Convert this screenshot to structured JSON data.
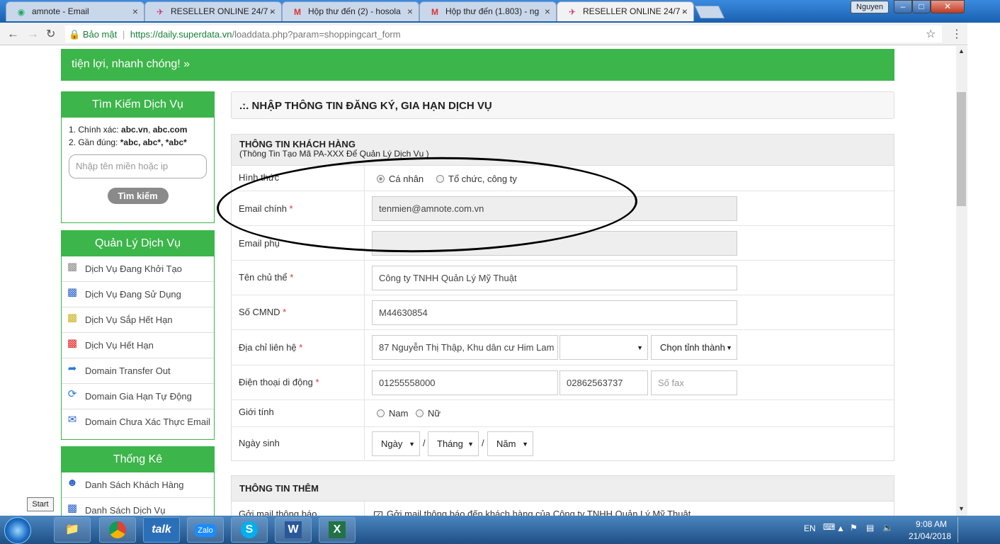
{
  "browser": {
    "tabs": [
      {
        "title": "amnote - Email",
        "icon": "globe-icon"
      },
      {
        "title": "RESELLER ONLINE 24/7 -",
        "icon": "reseller-icon"
      },
      {
        "title": "Hộp thư đến (2) - hosola",
        "icon": "gmail-icon"
      },
      {
        "title": "Hộp thư đến (1.803) - ng",
        "icon": "gmail-icon"
      },
      {
        "title": "RESELLER ONLINE 24/7 -",
        "icon": "reseller-icon",
        "active": true
      }
    ],
    "user": "Nguyen",
    "security_label": "Bảo mật",
    "url_host": "https://daily.superdata.vn",
    "url_path": "/loaddata.php?param=shoppingcart_form"
  },
  "banner": {
    "text": "tiện lợi, nhanh chóng! »"
  },
  "search_box": {
    "title": "Tìm Kiếm Dịch Vụ",
    "hint1_prefix": "1. Chính xác: ",
    "hint1_bold": "abc.vn",
    "hint1_sep": ", ",
    "hint1_bold2": "abc.com",
    "hint2_prefix": "2. Gần đúng: ",
    "hint2_bold": "*abc, abc*, *abc*",
    "placeholder": "Nhập tên miền hoặc ip",
    "button": "Tìm kiếm"
  },
  "manage_box": {
    "title": "Quản Lý Dịch Vụ",
    "items": [
      {
        "label": "Dịch Vụ Đang Khởi Tạo",
        "icon": "init-service-icon"
      },
      {
        "label": "Dịch Vụ Đang Sử Dụng",
        "icon": "active-service-icon"
      },
      {
        "label": "Dịch Vụ Sắp Hết Hạn",
        "icon": "expiring-service-icon"
      },
      {
        "label": "Dịch Vụ Hết Hạn",
        "icon": "expired-service-icon"
      },
      {
        "label": "Domain Transfer Out",
        "icon": "transfer-icon"
      },
      {
        "label": "Domain Gia Hạn Tự Động",
        "icon": "auto-renew-icon"
      },
      {
        "label": "Domain Chưa Xác Thực Email",
        "icon": "unverified-email-icon"
      }
    ]
  },
  "stats_box": {
    "title": "Thống Kê",
    "items": [
      {
        "label": "Danh Sách Khách Hàng",
        "icon": "customers-icon"
      },
      {
        "label": "Danh Sách Dịch Vụ",
        "icon": "services-icon"
      }
    ]
  },
  "form": {
    "title": ".:. NHẬP THÔNG TIN ĐĂNG KÝ, GIA HẠN DỊCH VỤ",
    "customer_section": {
      "heading": "THÔNG TIN KHÁCH HÀNG",
      "subheading": "(Thông Tin Tạo Mã PA-XXX Để Quản Lý Dịch Vụ )"
    },
    "type_label": "Hình thức",
    "type_options": [
      "Cá nhân",
      "Tổ chức, công ty"
    ],
    "type_selected": "Cá nhân",
    "email_label": "Email chính",
    "email_value": "tenmien@amnote.com.vn",
    "email2_label": "Email phụ",
    "email2_value": "",
    "owner_label": "Tên chủ thể",
    "owner_value": "Công ty TNHH Quản Lý Mỹ Thuật",
    "id_label": "Số CMND",
    "id_value": "M44630854",
    "address_label": "Địa chỉ liên hệ",
    "address_value": "87 Nguyễn Thị Thập, Khu dân cư Him Lam",
    "district_value": "",
    "province_value": "Chọn tỉnh thành",
    "phone_label": "Điện thoại di động",
    "mobile_value": "01255558000",
    "phone_value": "02862563737",
    "fax_placeholder": "Số fax",
    "gender_label": "Giới tính",
    "gender_options": [
      "Nam",
      "Nữ"
    ],
    "dob_label": "Ngày sinh",
    "dob_day": "Ngày",
    "dob_month": "Tháng",
    "dob_year": "Năm",
    "date_sep": "/",
    "required_mark": "*",
    "extra_section": {
      "heading": "THÔNG TIN THÊM"
    },
    "notify_label": "Gởi mail thông báo",
    "notify_text": "Gởi mail thông báo đến khách hàng của Công ty TNHH Quản Lý Mỹ Thuật",
    "notify_checked": true
  },
  "taskbar": {
    "start_tooltip": "Start",
    "apps": [
      "explorer",
      "chrome",
      "talk",
      "zalo",
      "skype",
      "word",
      "excel"
    ],
    "app_labels": {
      "talk": "talk",
      "zalo": "Zalo"
    },
    "language": "EN",
    "time": "9:08 AM",
    "date": "21/04/2018"
  }
}
